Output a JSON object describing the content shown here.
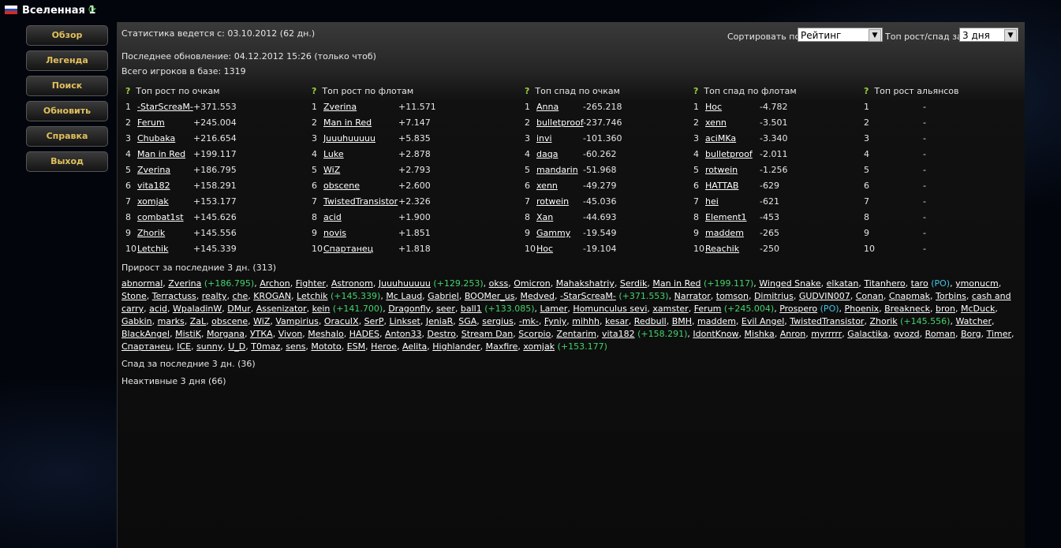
{
  "header": {
    "title": "Вселенная 1"
  },
  "sidebar": [
    "Обзор",
    "Легенда",
    "Поиск",
    "Обновить",
    "Справка",
    "Выход"
  ],
  "stats": {
    "since": "Статистика ведется с: 03.10.2012 (62 дн.)",
    "updated": "Последнее обновление: 04.12.2012 15:26 (только чтоб)",
    "total": "Всего игроков в базе: 1319"
  },
  "controls": {
    "sort_label": "Сортировать по:",
    "sort_value": "Рейтинг",
    "period_label": "Топ рост/спад за:",
    "period_value": "3 дня"
  },
  "top_tables": [
    {
      "title": "Топ рост по очкам",
      "rows": [
        [
          "1",
          "-StarScreaM-",
          "+371.553"
        ],
        [
          "2",
          "Ferum",
          "+245.004"
        ],
        [
          "3",
          "Chubaka",
          "+216.654"
        ],
        [
          "4",
          "Man in Red",
          "+199.117"
        ],
        [
          "5",
          "Zverina",
          "+186.795"
        ],
        [
          "6",
          "vita182",
          "+158.291"
        ],
        [
          "7",
          "xomjak",
          "+153.177"
        ],
        [
          "8",
          "combat1st",
          "+145.626"
        ],
        [
          "9",
          "Zhorik",
          "+145.556"
        ],
        [
          "10",
          "Letchik",
          "+145.339"
        ]
      ]
    },
    {
      "title": "Топ рост по флотам",
      "rows": [
        [
          "1",
          "Zverina",
          "+11.571"
        ],
        [
          "2",
          "Man in Red",
          "+7.147"
        ],
        [
          "3",
          "Juuuhuuuuu",
          "+5.835"
        ],
        [
          "4",
          "Luke",
          "+2.878"
        ],
        [
          "5",
          "WiZ",
          "+2.793"
        ],
        [
          "6",
          "obscene",
          "+2.600"
        ],
        [
          "7",
          "TwistedTransistor",
          "+2.326"
        ],
        [
          "8",
          "acid",
          "+1.900"
        ],
        [
          "9",
          "novis",
          "+1.851"
        ],
        [
          "10",
          "Спартанец",
          "+1.818"
        ]
      ]
    },
    {
      "title": "Топ спад по очкам",
      "rows": [
        [
          "1",
          "Anna",
          "-265.218"
        ],
        [
          "2",
          "bulletproof",
          "-237.746"
        ],
        [
          "3",
          "invi",
          "-101.360"
        ],
        [
          "4",
          "daqa",
          "-60.262"
        ],
        [
          "5",
          "mandarin",
          "-51.968"
        ],
        [
          "6",
          "xenn",
          "-49.279"
        ],
        [
          "7",
          "rotwein",
          "-45.036"
        ],
        [
          "8",
          "Xan",
          "-44.693"
        ],
        [
          "9",
          "Gammy",
          "-19.549"
        ],
        [
          "10",
          "Hoc",
          "-19.104"
        ]
      ]
    },
    {
      "title": "Топ спад по флотам",
      "rows": [
        [
          "1",
          "Hoc",
          "-4.782"
        ],
        [
          "2",
          "xenn",
          "-3.501"
        ],
        [
          "3",
          "aciMKa",
          "-3.340"
        ],
        [
          "4",
          "bulletproof",
          "-2.011"
        ],
        [
          "5",
          "rotwein",
          "-1.256"
        ],
        [
          "6",
          "HATTAB",
          "-629"
        ],
        [
          "7",
          "hei",
          "-621"
        ],
        [
          "8",
          "Element1",
          "-453"
        ],
        [
          "9",
          "maddem",
          "-265"
        ],
        [
          "10",
          "Reachik",
          "-250"
        ]
      ]
    },
    {
      "title": "Топ рост альянсов",
      "rows": [
        [
          "1",
          "",
          "-"
        ],
        [
          "2",
          "",
          "-"
        ],
        [
          "3",
          "",
          "-"
        ],
        [
          "4",
          "",
          "-"
        ],
        [
          "5",
          "",
          "-"
        ],
        [
          "6",
          "",
          "-"
        ],
        [
          "7",
          "",
          "-"
        ],
        [
          "8",
          "",
          "-"
        ],
        [
          "9",
          "",
          "-"
        ],
        [
          "10",
          "",
          "-"
        ]
      ]
    }
  ],
  "growth_title": "Прирост за последние 3 дн. (313)",
  "growth": [
    [
      "abnormal"
    ],
    [
      "Zverina",
      "+186.795"
    ],
    [
      "Archon"
    ],
    [
      "Fighter"
    ],
    [
      "Astronom"
    ],
    [
      "Juuuhuuuuu",
      "+129.253"
    ],
    [
      "okss"
    ],
    [
      "Omicron"
    ],
    [
      "Mahakshatriy"
    ],
    [
      "Serdik"
    ],
    [
      "Man in Red",
      "+199.117"
    ],
    [
      "Winged Snake"
    ],
    [
      "elkatan"
    ],
    [
      "Titanhero"
    ],
    [
      "taro",
      "",
      "PO"
    ],
    [
      "ymonucm"
    ],
    [
      "Stone"
    ],
    [
      "Terractuss"
    ],
    [
      "realty"
    ],
    [
      "che"
    ],
    [
      "KROGAN"
    ],
    [
      "Letchik",
      "+145.339"
    ],
    [
      "Mc Laud"
    ],
    [
      "Gabriel"
    ],
    [
      "BOOMer_us"
    ],
    [
      "Medved"
    ],
    [
      "-StarScreaM-",
      "+371.553"
    ],
    [
      "Narrator"
    ],
    [
      "tomson"
    ],
    [
      "Dimitrius"
    ],
    [
      "GUDVIN007"
    ],
    [
      "Conan"
    ],
    [
      "Cnapmak"
    ],
    [
      "Torbins"
    ],
    [
      "cash and carry"
    ],
    [
      "acid"
    ],
    [
      "WpaladinW"
    ],
    [
      "DMur"
    ],
    [
      "Assenizator"
    ],
    [
      "kein",
      "+141.700"
    ],
    [
      "Dragonfly"
    ],
    [
      "seer"
    ],
    [
      "ball1",
      "+133.085"
    ],
    [
      "Lamer"
    ],
    [
      "Homunculus sevi"
    ],
    [
      "xamster"
    ],
    [
      "Ferum",
      "+245.004"
    ],
    [
      "Prospero",
      "",
      "PO"
    ],
    [
      "Phoenix"
    ],
    [
      "Breakneck"
    ],
    [
      "bron"
    ],
    [
      "McDuck"
    ],
    [
      "Gabkin"
    ],
    [
      "marks"
    ],
    [
      "ZaL"
    ],
    [
      "obscene"
    ],
    [
      "WiZ"
    ],
    [
      "Vampirius"
    ],
    [
      "OracuIX"
    ],
    [
      "SerP"
    ],
    [
      "Linkset"
    ],
    [
      "JeniaR"
    ],
    [
      "SGA"
    ],
    [
      "sergius"
    ],
    [
      "-mk-"
    ],
    [
      "Fyniy"
    ],
    [
      "mihhh"
    ],
    [
      "kesar"
    ],
    [
      "Redbull"
    ],
    [
      "BMH"
    ],
    [
      "maddem"
    ],
    [
      "Evil Angel"
    ],
    [
      "TwistedTransistor"
    ],
    [
      "Zhorik",
      "+145.556"
    ],
    [
      "Watcher"
    ],
    [
      "BlackAngel"
    ],
    [
      "MistiK"
    ],
    [
      "Morgana"
    ],
    [
      "УТКА"
    ],
    [
      "Vivon"
    ],
    [
      "Meshalo"
    ],
    [
      "HADES"
    ],
    [
      "Anton33"
    ],
    [
      "Destro"
    ],
    [
      "Stream Dan"
    ],
    [
      "Scorpio"
    ],
    [
      "Zentarim"
    ],
    [
      "vita182",
      "+158.291"
    ],
    [
      "IdontKnow"
    ],
    [
      "Mishka"
    ],
    [
      "Anron"
    ],
    [
      "myrrrrr"
    ],
    [
      "Galactika"
    ],
    [
      "gvozd"
    ],
    [
      "Roman"
    ],
    [
      "Borg"
    ],
    [
      "Timer"
    ],
    [
      "Спартанец"
    ],
    [
      "ICE"
    ],
    [
      "sunny"
    ],
    [
      "U_D"
    ],
    [
      "T0maz"
    ],
    [
      "sens"
    ],
    [
      "Mototo"
    ],
    [
      "ESM"
    ],
    [
      "Heroe"
    ],
    [
      "Aelita"
    ],
    [
      "Highlander"
    ],
    [
      "Maxfire"
    ],
    [
      "xomjak",
      "+153.177"
    ]
  ],
  "decline_title": "Спад за последние 3 дн. (36)",
  "inactive_title": "Неактивные 3 дня (66)"
}
